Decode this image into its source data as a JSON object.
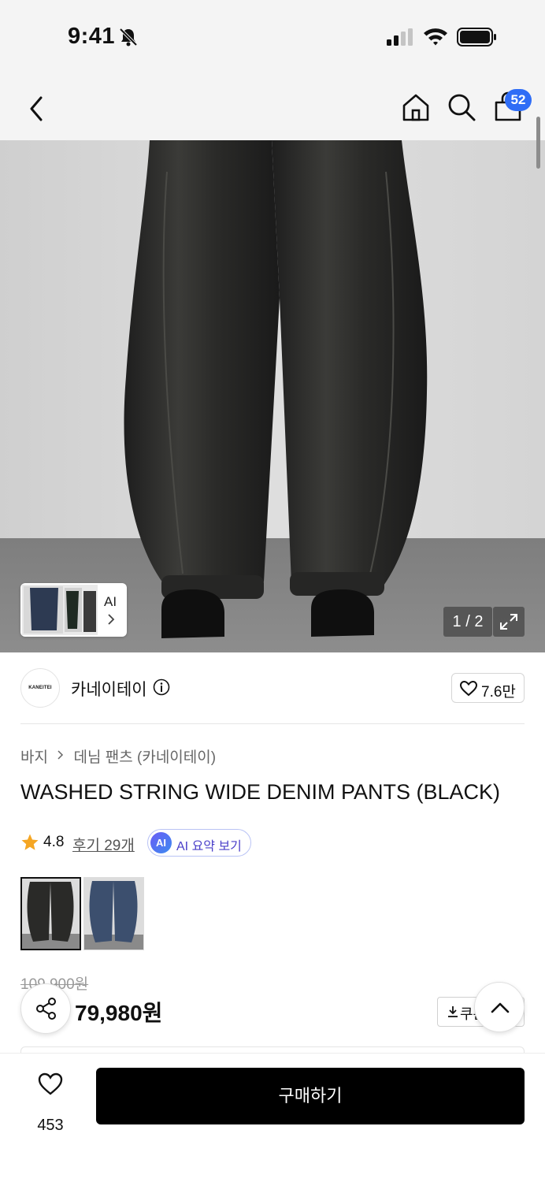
{
  "status_bar": {
    "time": "9:41"
  },
  "nav": {
    "cart_count": "52"
  },
  "gallery": {
    "ai_label": "AI",
    "page_indicator": "1 / 2"
  },
  "brand": {
    "logo_text": "KANEITEI",
    "name": "카네이테이",
    "like_count": "7.6만"
  },
  "breadcrumb": [
    "바지",
    "데님 팬츠 (카네이테이)"
  ],
  "product": {
    "title": "WASHED STRING WIDE DENIM PANTS (BLACK)",
    "rating": "4.8",
    "reviews": "후기 29개",
    "ai_badge": "AI",
    "ai_summary": "AI 요약 보기",
    "original_price": "109,900원",
    "sale_price": "79,980원",
    "coupon_label": "쿠폰"
  },
  "bottom_bar": {
    "wish_count": "453",
    "buy_label": "구매하기"
  },
  "colors": {
    "accent": "#2f6df6",
    "star": "#f5a623",
    "buy_button": "#000000"
  }
}
